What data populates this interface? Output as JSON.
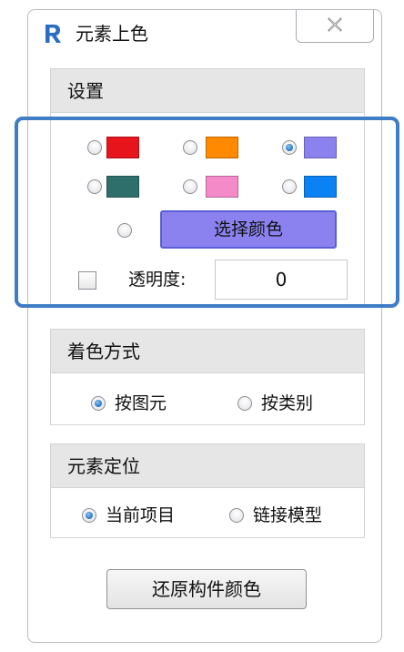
{
  "window": {
    "title": "元素上色",
    "app_icon": "revit-r-icon",
    "close_icon": "close-icon"
  },
  "settings": {
    "header": "设置",
    "colors": [
      {
        "name": "red-swatch",
        "color": "#e8141c",
        "checked": false
      },
      {
        "name": "orange-swatch",
        "color": "#ff8a00",
        "checked": false
      },
      {
        "name": "lavender-swatch",
        "color": "#8b82f0",
        "checked": true
      },
      {
        "name": "teal-swatch",
        "color": "#2f6f6b",
        "checked": false
      },
      {
        "name": "pink-swatch",
        "color": "#f58ac8",
        "checked": false
      },
      {
        "name": "blue-swatch",
        "color": "#0a82f4",
        "checked": false
      }
    ],
    "choose_color_label": "选择颜色",
    "opacity_label": "透明度:",
    "opacity_value": "0"
  },
  "coloring_mode": {
    "header": "着色方式",
    "options": [
      {
        "label": "按图元",
        "checked": true
      },
      {
        "label": "按类别",
        "checked": false
      }
    ]
  },
  "element_location": {
    "header": "元素定位",
    "options": [
      {
        "label": "当前项目",
        "checked": true
      },
      {
        "label": "链接模型",
        "checked": false
      }
    ]
  },
  "restore_button_label": "还原构件颜色",
  "colors": {
    "highlight_border": "#3f7dc4",
    "button_fill": "#8b82f0",
    "panel_header_bg": "#e6e6e6"
  }
}
